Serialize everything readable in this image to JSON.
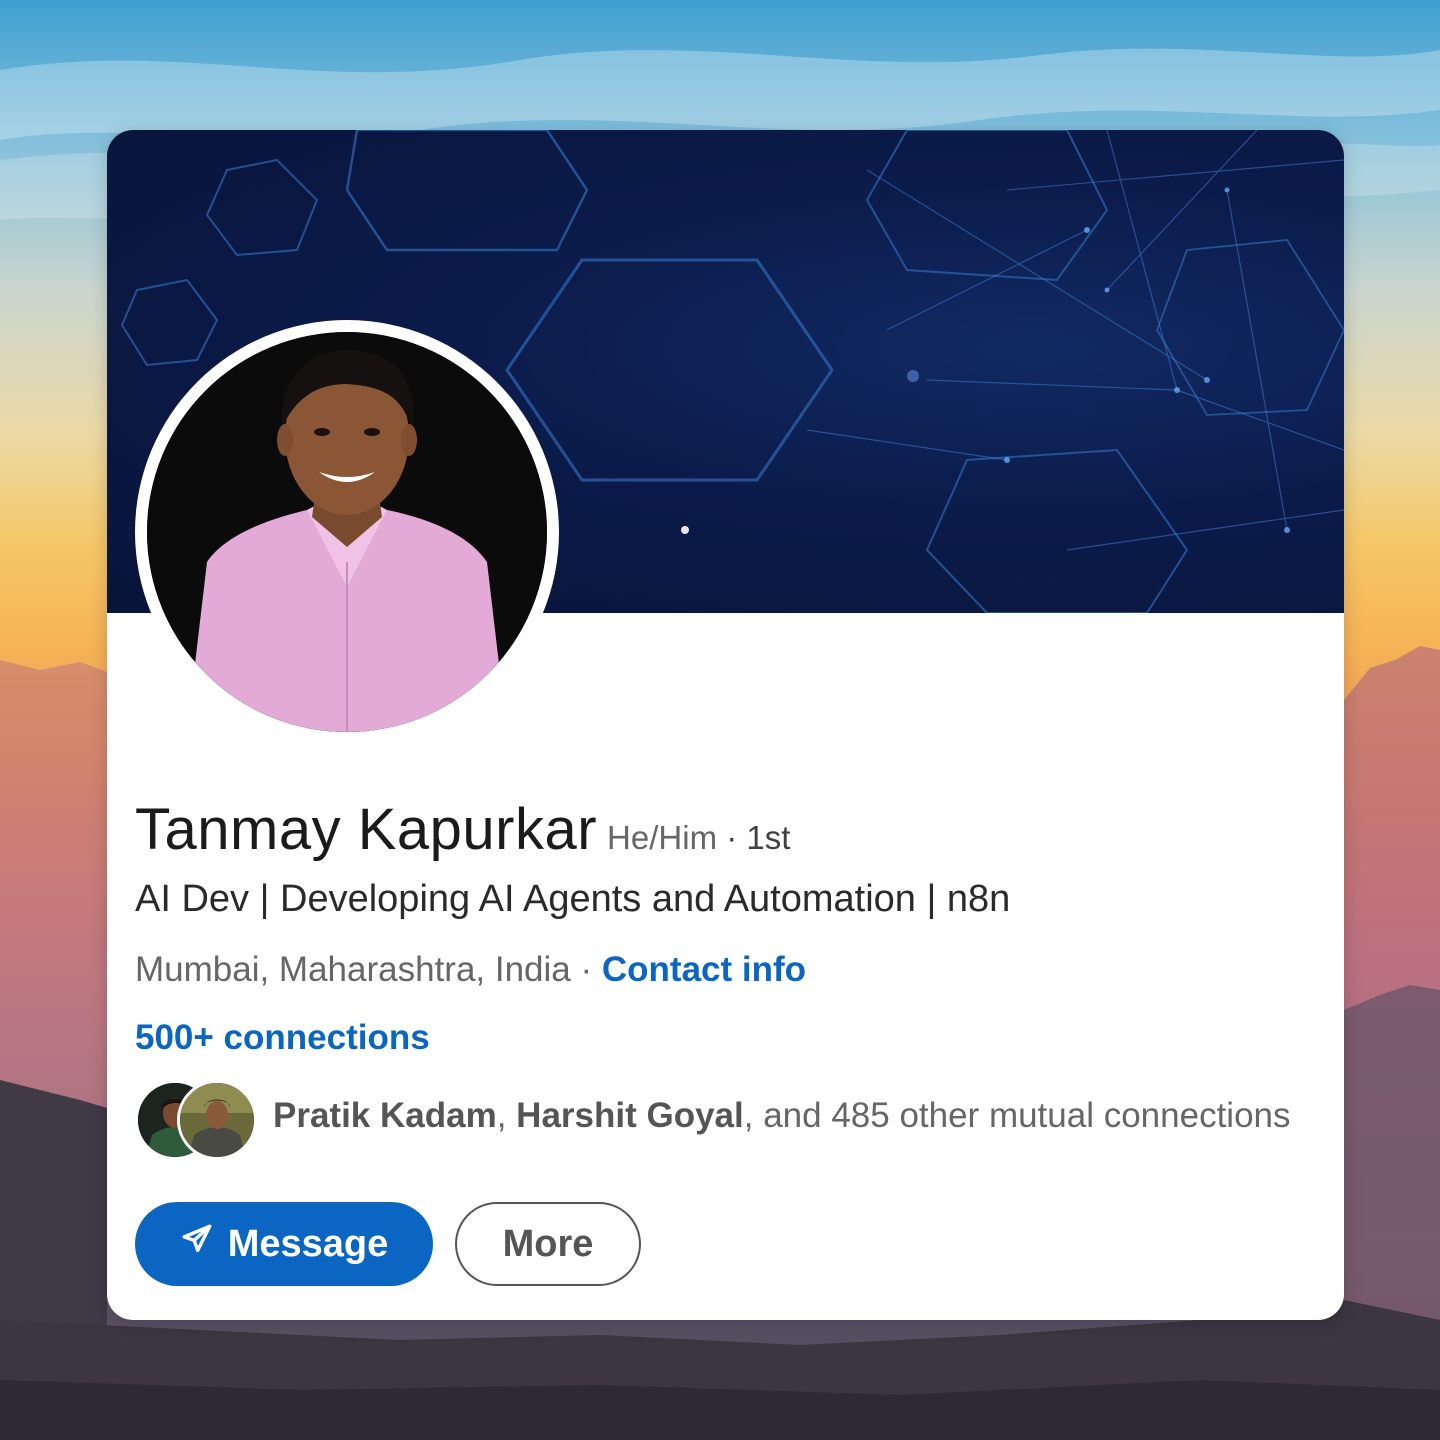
{
  "profile": {
    "name": "Tanmay Kapurkar",
    "pronouns": "He/Him",
    "degree_separator": " · ",
    "degree": "1st",
    "headline": "AI Dev | Developing AI Agents and Automation | n8n",
    "location": "Mumbai, Maharashtra, India",
    "location_separator": " · ",
    "contact_info_label": "Contact info",
    "connections_label": "500+ connections"
  },
  "mutual": {
    "first": "Pratik Kadam",
    "separator": ", ",
    "second": "Harshit Goyal",
    "rest": ", and 485 other mutual connections"
  },
  "actions": {
    "message_label": "Message",
    "more_label": "More"
  },
  "icons": {
    "message": "send-icon"
  },
  "colors": {
    "accent": "#0a66c2",
    "banner": "#0b1b4a"
  }
}
